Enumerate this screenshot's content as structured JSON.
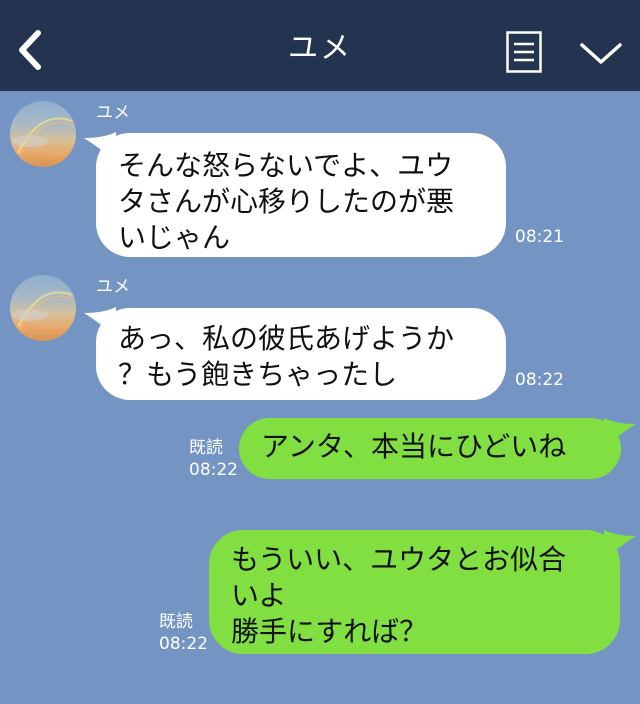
{
  "header": {
    "title": "ユメ",
    "back_icon": "chevron-left-icon",
    "menu_icon": "list-icon",
    "collapse_icon": "chevron-down-icon"
  },
  "colors": {
    "header_bg": "#243450",
    "chat_bg": "#7495c4",
    "incoming_bubble": "#ffffff",
    "outgoing_bubble": "#81df42"
  },
  "messages": [
    {
      "direction": "incoming",
      "sender": "ユメ",
      "text": "そんな怒らないでよ、ユウ\nタさんが心移りしたのが悪\nいじゃん",
      "time": "08:21"
    },
    {
      "direction": "incoming",
      "sender": "ユメ",
      "text": "あっ、私の彼氏あげようか\n？もう飽きちゃったし",
      "time": "08:22"
    },
    {
      "direction": "outgoing",
      "read": "既読",
      "text": "アンタ、本当にひどいね",
      "time": "08:22"
    },
    {
      "direction": "outgoing",
      "read": "既読",
      "text": "もういい、ユウタとお似合\nいよ\n勝手にすれば？",
      "time": "08:22"
    }
  ]
}
